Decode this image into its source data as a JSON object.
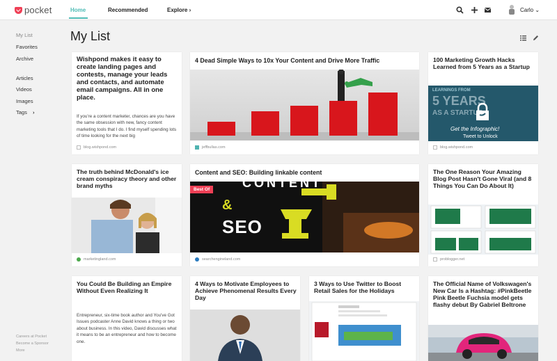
{
  "app": {
    "name": "pocket"
  },
  "header": {
    "tabs": [
      "Home",
      "Recommended",
      "Explore"
    ],
    "user_name": "Carlo",
    "explore_chevron": "›",
    "user_chevron": "⌄"
  },
  "sidebar": {
    "items": [
      "My List",
      "Favorites",
      "Archive",
      "Articles",
      "Videos",
      "Images",
      "Tags"
    ],
    "tags_chevron": "›",
    "footer": [
      "Careers at Pocket",
      "Become a Sponsor",
      "More"
    ]
  },
  "main": {
    "title": "My List",
    "cards": [
      {
        "title": "Wishpond makes it easy to create landing pages and contests, manage your leads and contacts, and automate email campaigns. All in one place.",
        "excerpt": "If you're a content marketer, chances are you have the same obsession with new, fancy content marketing tools that I do. I find myself spending lots of time looking for the next big",
        "source": "blog.wishpond.com"
      },
      {
        "title": "4 Dead Simple Ways to 10x Your Content and Drive More Traffic",
        "source": "jeffbullas.com"
      },
      {
        "title": "100 Marketing Growth Hacks Learned from 5 Years as a Startup",
        "image_text": [
          "LEARNINGS FROM",
          "5 YEARS",
          "AS A STARTUP",
          "Get the Infographic!",
          "Tweet to Unlock"
        ],
        "source": "blog.wishpond.com"
      },
      {
        "title": "The truth behind McDonald's ice cream conspiracy theory and other brand myths",
        "source": "marketingland.com"
      },
      {
        "title": "Content and SEO: Building linkable content",
        "badge": "Best Of",
        "image_text": [
          "CONTENT",
          "&",
          "SEO"
        ],
        "source": "searchengineland.com"
      },
      {
        "title": "The One Reason Your Amazing Blog Post Hasn't Gone Viral (and 8 Things You Can Do About It)",
        "source": "problogger.net"
      },
      {
        "title": "You Could Be Building an Empire Without Even Realizing It",
        "excerpt": "Entrepreneur, six-time book author and You've Got Issues podcaster Anne David knows a thing or two about business. In this video, David discusses what it means to be an entrepreneur and how to become one."
      },
      {
        "title": "4 Ways to Motivate Employees to Achieve Phenomenal Results Every Day"
      },
      {
        "title": "3 Ways to Use Twitter to Boost Retail Sales for the Holidays"
      },
      {
        "title": "The Official Name of Volkswagen's New Car Is a Hashtag: #PinkBeetle Pink Beetle Fuchsia model gets flashy debut By Gabriel Beltrone"
      }
    ]
  }
}
